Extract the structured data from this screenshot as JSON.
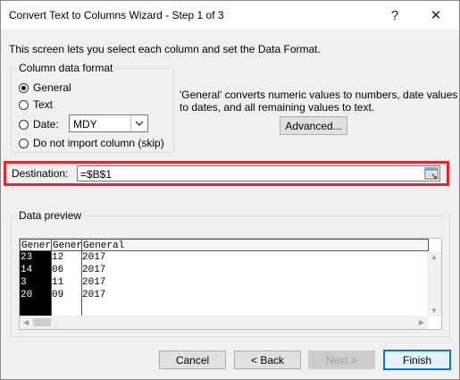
{
  "window": {
    "title": "Convert Text to Columns Wizard - Step 1 of 3",
    "help": "?",
    "close": "✕"
  },
  "description": "This screen lets you select each column and set the Data Format.",
  "column_format": {
    "legend": "Column data format",
    "options": [
      {
        "label": "General",
        "checked": true
      },
      {
        "label": "Text",
        "checked": false
      },
      {
        "label": "Date:",
        "checked": false
      },
      {
        "label": "Do not import column (skip)",
        "checked": false
      }
    ],
    "date_value": "MDY"
  },
  "info": {
    "line1": "'General' converts numeric values to numbers, date values",
    "line2": "to dates, and all remaining values to text."
  },
  "buttons": {
    "advanced": "Advanced...",
    "cancel": "Cancel",
    "back": "< Back",
    "next": "Next >",
    "finish": "Finish"
  },
  "destination": {
    "label": "Destination:",
    "value": "=$B$1"
  },
  "preview": {
    "legend": "Data preview",
    "headers": [
      "Gener",
      "Gener",
      "General"
    ],
    "rows": [
      [
        "23",
        "12",
        "2017"
      ],
      [
        "14",
        "06",
        "2017"
      ],
      [
        "3",
        "11",
        "2017"
      ],
      [
        "20",
        "09",
        "2017"
      ]
    ]
  }
}
